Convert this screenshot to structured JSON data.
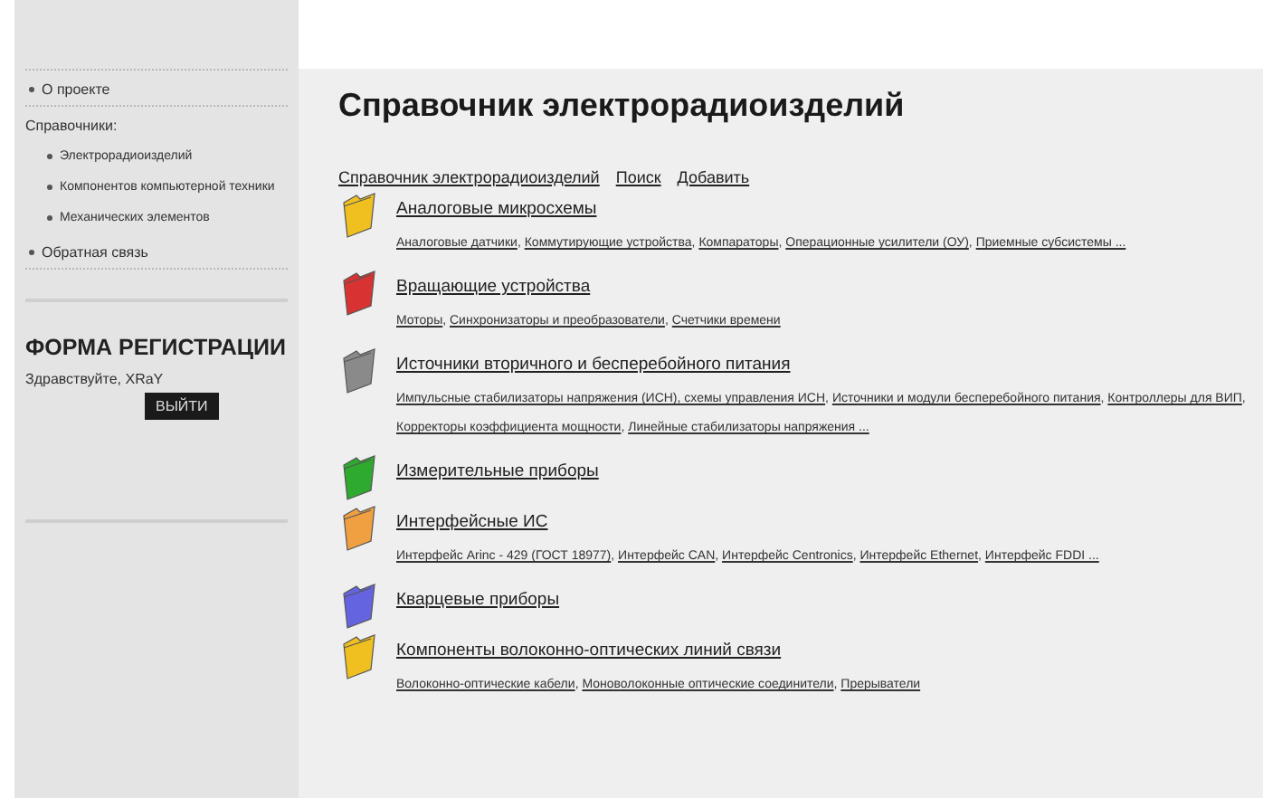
{
  "sidebar": {
    "menu": [
      {
        "kind": "link",
        "label": "О проекте"
      },
      {
        "kind": "heading",
        "label": "Справочники:",
        "children": [
          {
            "label": "Электрорадиоизделий"
          },
          {
            "label": "Компонентов компьютерной техники"
          },
          {
            "label": "Механических элементов"
          }
        ]
      },
      {
        "kind": "link",
        "label": "Обратная связь"
      }
    ],
    "registration": {
      "title": "ФОРМА РЕГИСТРАЦИИ",
      "greeting": "Здравствуйте, XRaY",
      "logout_button": "ВЫЙТИ"
    }
  },
  "page_title": "Справочник электрорадиоизделий",
  "link_separator": ",",
  "nav_links": [
    "Справочник электрорадиоизделий",
    "Поиск",
    "Добавить"
  ],
  "categories": [
    {
      "title": "Аналоговые микросхемы",
      "color": "#f0c020",
      "links": [
        "Аналоговые датчики",
        "Коммутирующие устройства",
        "Компараторы",
        "Операционные усилители (ОУ)",
        "Приемные субсистемы ..."
      ]
    },
    {
      "title": "Вращающие устройства",
      "color": "#d83232",
      "links": [
        "Моторы",
        "Синхронизаторы и преобразователи",
        "Счетчики времени"
      ]
    },
    {
      "title": "Источники вторичного и бесперебойного питания",
      "color": "#8a8a8a",
      "links": [
        "Импульсные стабилизаторы напряжения (ИСН), схемы управления ИСН",
        "Источники и модули бесперебойного питания",
        "Контроллеры для ВИП",
        "Корректоры коэффициента мощности",
        "Линейные стабилизаторы напряжения ..."
      ]
    },
    {
      "title": "Измерительные приборы",
      "color": "#2eaa2e"
    },
    {
      "title": "Интерфейсные ИС",
      "color": "#f0a040",
      "links": [
        "Интерфейс Arinc - 429 (ГОСТ 18977)",
        "Интерфейс CAN",
        "Интерфейс Centronics",
        "Интерфейс Ethernet",
        "Интерфейс FDDI ..."
      ]
    },
    {
      "title": "Кварцевые приборы",
      "color": "#6464e0"
    },
    {
      "title": "Компоненты волоконно-оптических линий связи",
      "color": "#f0c020",
      "links": [
        "Волоконно-оптические кабели",
        "Моноволоконные оптические соединители",
        "Прерыватели"
      ]
    }
  ]
}
